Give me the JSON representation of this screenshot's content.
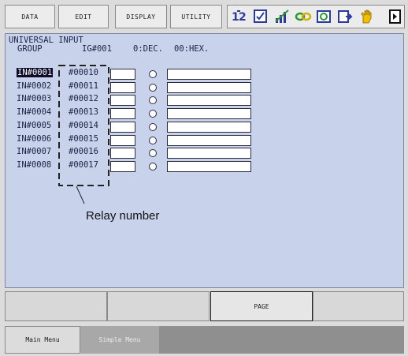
{
  "menubar": {
    "data_label": "DATA",
    "edit_label": "EDIT",
    "display_label": "DISPLAY",
    "utility_label": "UTILITY",
    "icons": [
      "mode-switch-icon",
      "check-icon",
      "signal-icon",
      "link-icon",
      "monitor-icon",
      "output-icon",
      "hand-icon",
      "next-icon"
    ]
  },
  "panel": {
    "title": "UNIVERSAL INPUT",
    "group_label": "GROUP",
    "group_value": "IG#001",
    "dec_label": "0:DEC.",
    "hex_label": "00:HEX.",
    "rows": [
      {
        "input": "IN#0001",
        "relay": "#00010"
      },
      {
        "input": "IN#0002",
        "relay": "#00011"
      },
      {
        "input": "IN#0003",
        "relay": "#00012"
      },
      {
        "input": "IN#0004",
        "relay": "#00013"
      },
      {
        "input": "IN#0005",
        "relay": "#00014"
      },
      {
        "input": "IN#0006",
        "relay": "#00015"
      },
      {
        "input": "IN#0007",
        "relay": "#00016"
      },
      {
        "input": "IN#0008",
        "relay": "#00017"
      }
    ]
  },
  "callout": {
    "text": "Relay number"
  },
  "fkeys": {
    "page_label": "PAGE"
  },
  "bottombar": {
    "main_menu": "Main Menu",
    "simple_menu": "Simple Menu"
  }
}
